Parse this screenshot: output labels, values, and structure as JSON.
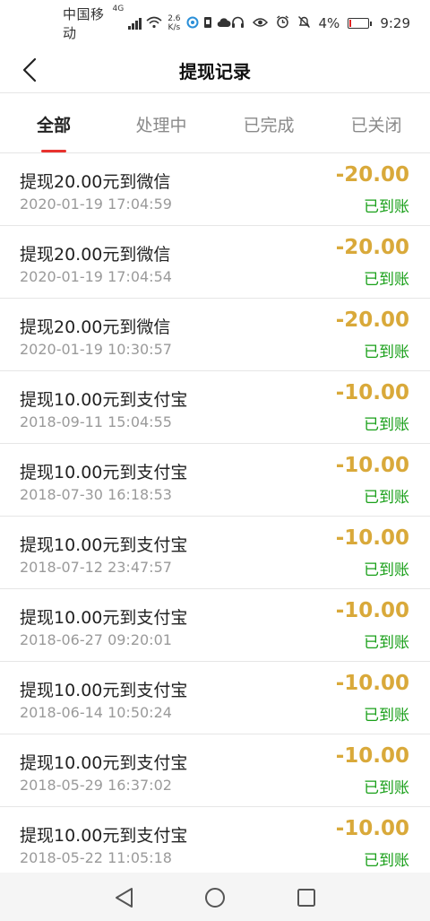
{
  "status_bar": {
    "carrier": "中国移动",
    "network_type": "4G",
    "speed_value": "2.6",
    "speed_unit": "K/s",
    "battery": "4%",
    "time": "9:29"
  },
  "header": {
    "title": "提现记录"
  },
  "tabs": [
    {
      "label": "全部"
    },
    {
      "label": "处理中"
    },
    {
      "label": "已完成"
    },
    {
      "label": "已关闭"
    }
  ],
  "records": [
    {
      "title": "提现20.00元到微信",
      "date": "2020-01-19 17:04:59",
      "amount": "-20.00",
      "status": "已到账"
    },
    {
      "title": "提现20.00元到微信",
      "date": "2020-01-19 17:04:54",
      "amount": "-20.00",
      "status": "已到账"
    },
    {
      "title": "提现20.00元到微信",
      "date": "2020-01-19 10:30:57",
      "amount": "-20.00",
      "status": "已到账"
    },
    {
      "title": "提现10.00元到支付宝",
      "date": "2018-09-11 15:04:55",
      "amount": "-10.00",
      "status": "已到账"
    },
    {
      "title": "提现10.00元到支付宝",
      "date": "2018-07-30 16:18:53",
      "amount": "-10.00",
      "status": "已到账"
    },
    {
      "title": "提现10.00元到支付宝",
      "date": "2018-07-12 23:47:57",
      "amount": "-10.00",
      "status": "已到账"
    },
    {
      "title": "提现10.00元到支付宝",
      "date": "2018-06-27 09:20:01",
      "amount": "-10.00",
      "status": "已到账"
    },
    {
      "title": "提现10.00元到支付宝",
      "date": "2018-06-14 10:50:24",
      "amount": "-10.00",
      "status": "已到账"
    },
    {
      "title": "提现10.00元到支付宝",
      "date": "2018-05-29 16:37:02",
      "amount": "-10.00",
      "status": "已到账"
    },
    {
      "title": "提现10.00元到支付宝",
      "date": "2018-05-22 11:05:18",
      "amount": "-10.00",
      "status": "已到账"
    }
  ],
  "colors": {
    "amount": "#d9a93a",
    "status_ok": "#1aa01a",
    "tab_indicator": "#e8322e"
  },
  "icons": {
    "back": "chevron-left-icon",
    "nav_back": "triangle-back-icon",
    "nav_home": "circle-home-icon",
    "nav_recent": "square-recent-icon"
  }
}
